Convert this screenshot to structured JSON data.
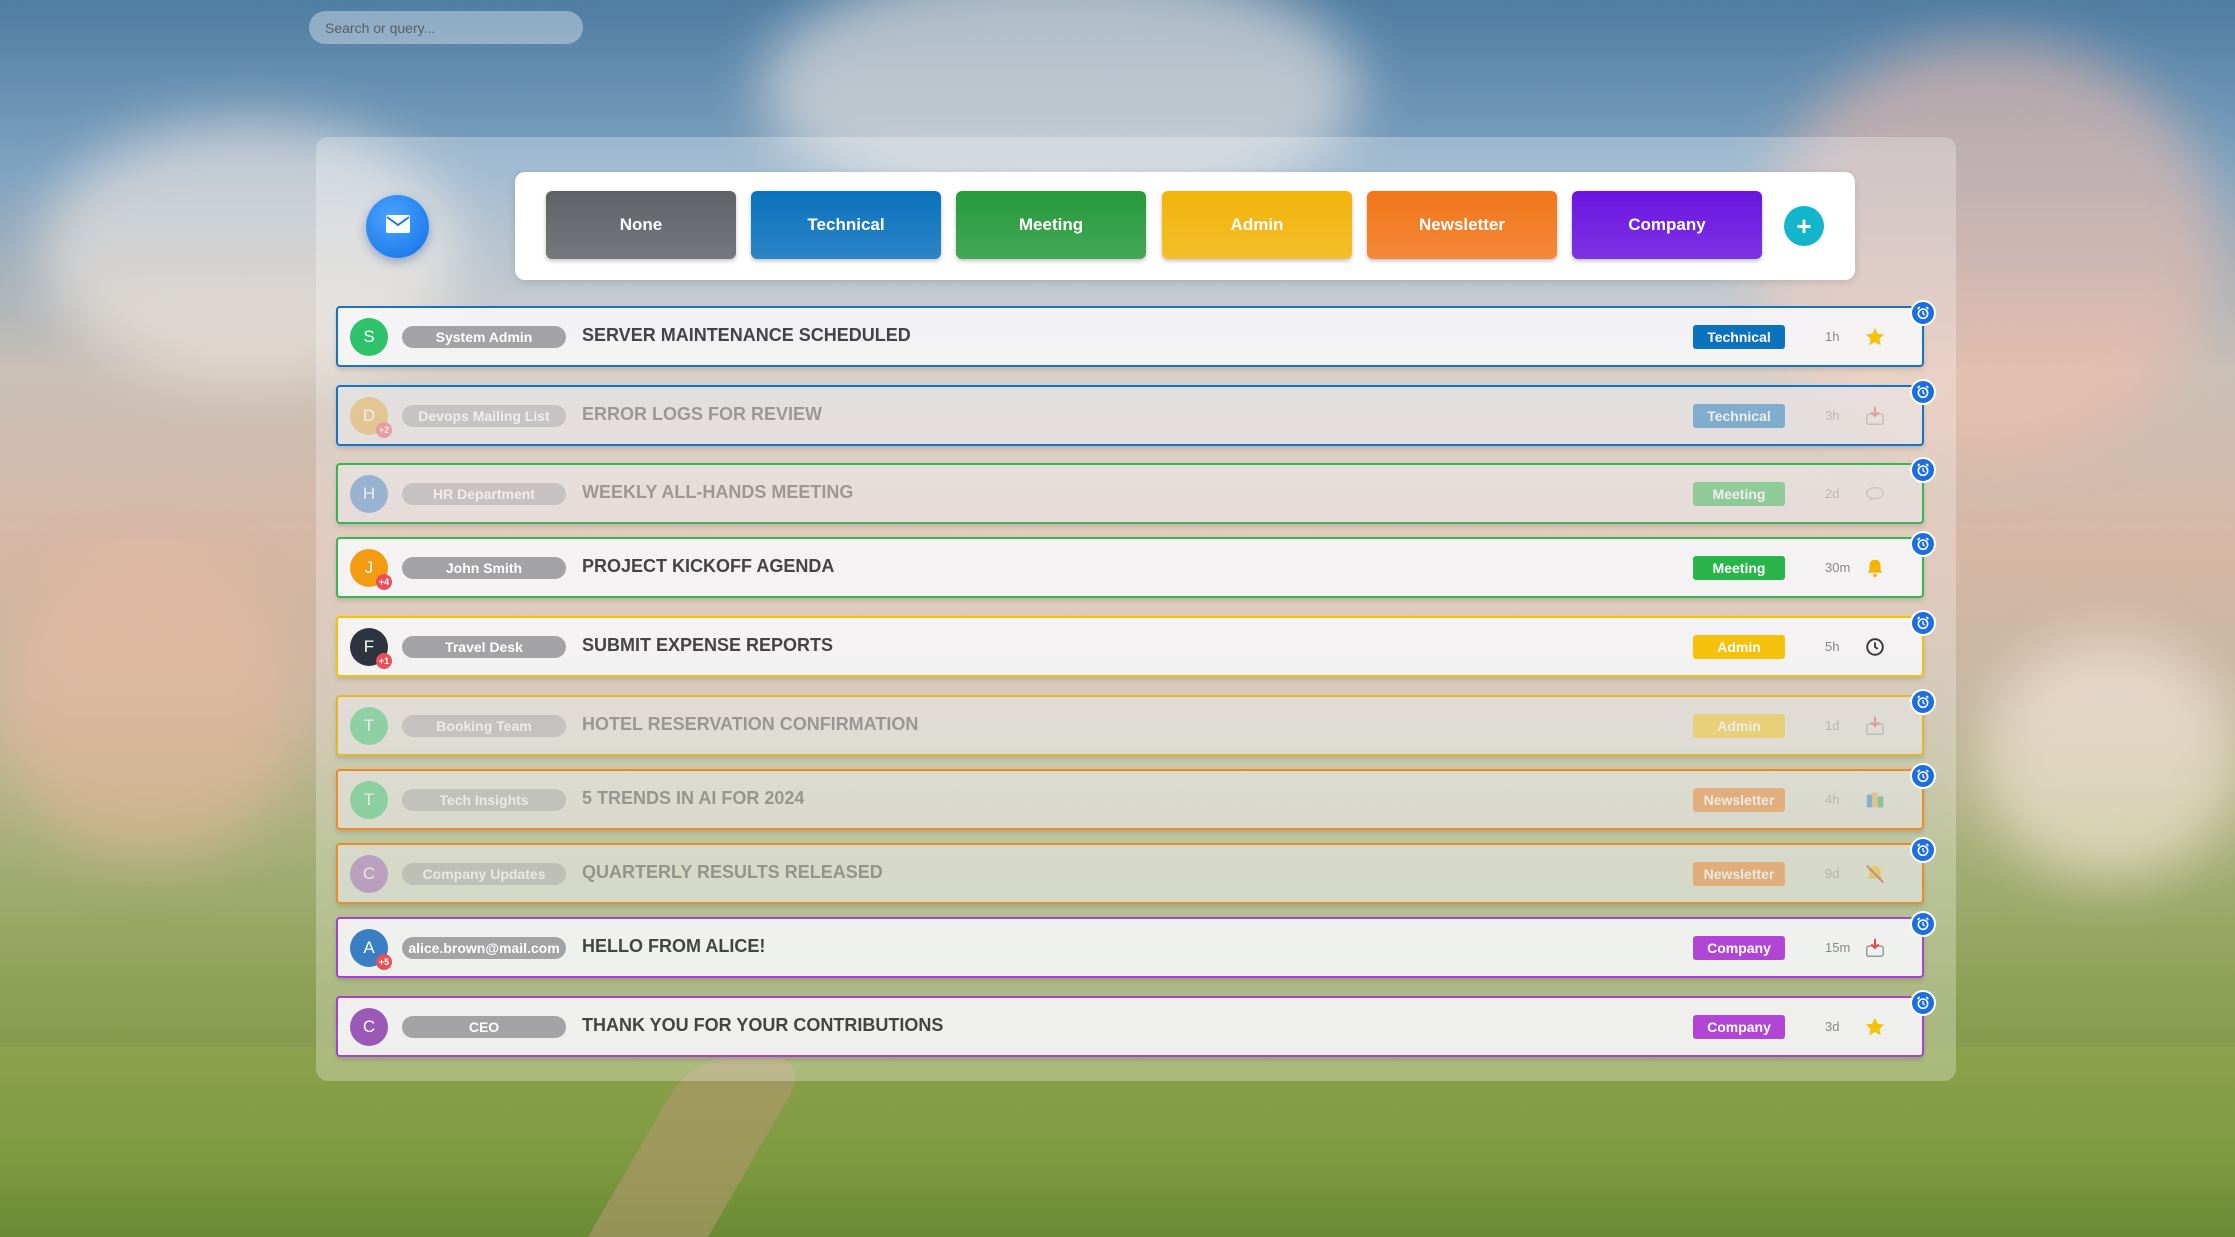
{
  "search": {
    "placeholder": "Search or query..."
  },
  "compose": {
    "icon": "envelope-icon"
  },
  "categories": [
    {
      "label": "None",
      "color": "#5f6368"
    },
    {
      "label": "Technical",
      "color": "#0b72bd"
    },
    {
      "label": "Meeting",
      "color": "#279a3c"
    },
    {
      "label": "Admin",
      "color": "#f2b40a"
    },
    {
      "label": "Newsletter",
      "color": "#f2761a"
    },
    {
      "label": "Company",
      "color": "#6a14e0"
    }
  ],
  "add_category": {
    "label": "+"
  },
  "emails": [
    {
      "avatar": "S",
      "avatar_color": "#2ec26a",
      "badge": "",
      "sender": "System Admin",
      "subject": "SERVER MAINTENANCE SCHEDULED",
      "tag": "Technical",
      "tag_color": "#0b72bd",
      "border": "#1774c4",
      "time": "1h",
      "icon": "star-icon",
      "dim": false
    },
    {
      "avatar": "D",
      "avatar_color": "#e0a93a",
      "badge": "+2",
      "sender": "Devops Mailing List",
      "subject": "ERROR LOGS FOR REVIEW",
      "tag": "Technical",
      "tag_color": "#0b72bd",
      "border": "#1774c4",
      "time": "3h",
      "icon": "inbox-download-icon",
      "dim": true
    },
    {
      "avatar": "H",
      "avatar_color": "#3a7fc4",
      "badge": "",
      "sender": "HR Department",
      "subject": "WEEKLY ALL-HANDS MEETING",
      "tag": "Meeting",
      "tag_color": "#2ab54a",
      "border": "#36b552",
      "time": "2d",
      "icon": "chat-bubble-icon",
      "dim": true
    },
    {
      "avatar": "J",
      "avatar_color": "#f39c12",
      "badge": "+4",
      "sender": "John Smith",
      "subject": "PROJECT KICKOFF AGENDA",
      "tag": "Meeting",
      "tag_color": "#2ab54a",
      "border": "#36b552",
      "time": "30m",
      "icon": "bell-icon",
      "dim": false
    },
    {
      "avatar": "F",
      "avatar_color": "#2d3440",
      "badge": "+1",
      "sender": "Travel Desk",
      "subject": "SUBMIT EXPENSE REPORTS",
      "tag": "Admin",
      "tag_color": "#f5c10c",
      "border": "#f2c011",
      "time": "5h",
      "icon": "clock-icon",
      "dim": false
    },
    {
      "avatar": "T",
      "avatar_color": "#2ec26a",
      "badge": "",
      "sender": "Booking Team",
      "subject": "HOTEL RESERVATION CONFIRMATION",
      "tag": "Admin",
      "tag_color": "#f5c10c",
      "border": "#e6b52a",
      "time": "1d",
      "icon": "inbox-download-icon",
      "dim": true
    },
    {
      "avatar": "T",
      "avatar_color": "#2ec26a",
      "badge": "",
      "sender": "Tech Insights",
      "subject": "5 TRENDS IN AI FOR 2024",
      "tag": "Newsletter",
      "tag_color": "#f0781f",
      "border": "#ee8a2a",
      "time": "4h",
      "icon": "books-icon",
      "dim": true
    },
    {
      "avatar": "C",
      "avatar_color": "#9b59b6",
      "badge": "",
      "sender": "Company Updates",
      "subject": "QUARTERLY RESULTS RELEASED",
      "tag": "Newsletter",
      "tag_color": "#f0781f",
      "border": "#ee8a2a",
      "time": "9d",
      "icon": "muted-bell-icon",
      "dim": true
    },
    {
      "avatar": "A",
      "avatar_color": "#3a7fc4",
      "badge": "+5",
      "sender": "alice.brown@mail.com",
      "subject": "HELLO FROM ALICE!",
      "tag": "Company",
      "tag_color": "#b146d6",
      "border": "#a741d0",
      "time": "15m",
      "icon": "inbox-download-icon",
      "dim": false
    },
    {
      "avatar": "C",
      "avatar_color": "#9b59b6",
      "badge": "",
      "sender": "CEO",
      "subject": "THANK YOU FOR YOUR CONTRIBUTIONS",
      "tag": "Company",
      "tag_color": "#b146d6",
      "border": "#a741d0",
      "time": "3d",
      "icon": "star-icon",
      "dim": false
    }
  ]
}
